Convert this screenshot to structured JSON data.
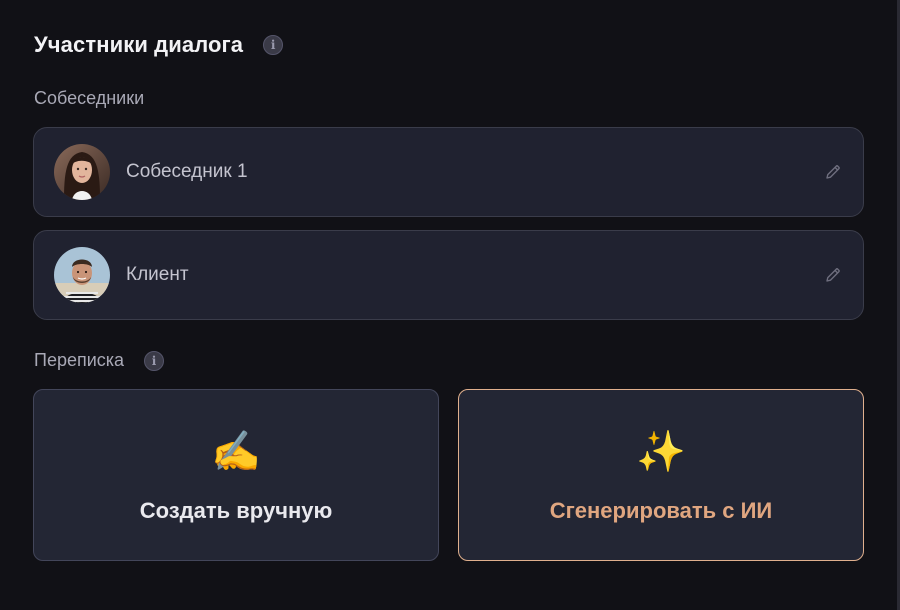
{
  "header": {
    "title": "Участники диалога",
    "info_icon": "info-icon"
  },
  "participants": {
    "section_label": "Собеседники",
    "items": [
      {
        "name": "Собеседник 1",
        "avatar": "avatar-woman",
        "edit_icon": "pencil-icon"
      },
      {
        "name": "Клиент",
        "avatar": "avatar-man",
        "edit_icon": "pencil-icon"
      }
    ]
  },
  "chat": {
    "section_label": "Переписка",
    "info_icon": "info-icon",
    "actions": [
      {
        "label": "Создать вручную",
        "icon": "✍️",
        "icon_name": "writing-hand-icon",
        "color": "#e9e9ee"
      },
      {
        "label": "Сгенерировать с ИИ",
        "icon": "✨",
        "icon_name": "sparkles-icon",
        "color": "#e0a680",
        "border": "#e0b08e"
      }
    ]
  }
}
